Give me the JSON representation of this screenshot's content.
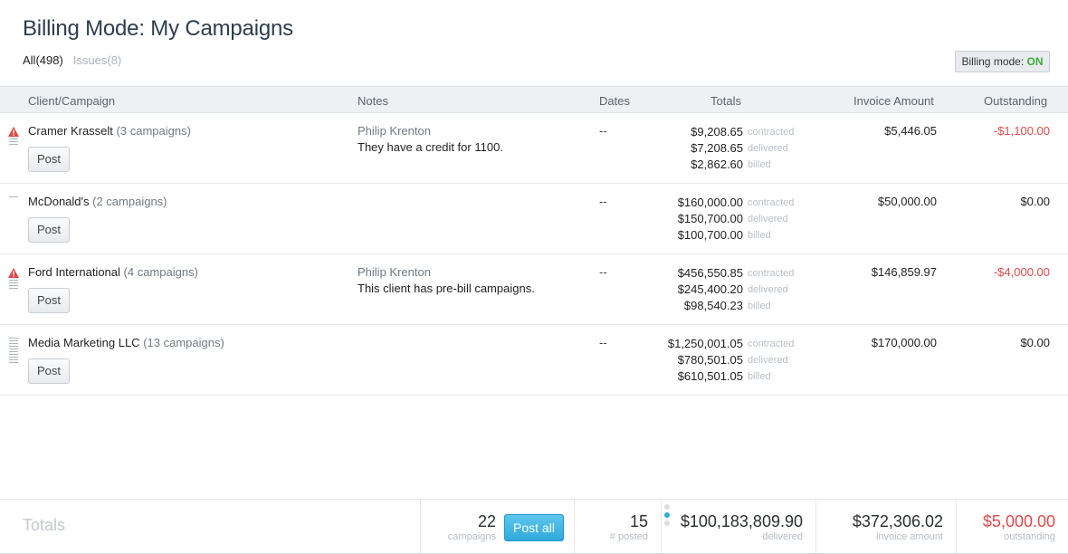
{
  "page": {
    "title": "Billing Mode: My Campaigns"
  },
  "filters": {
    "all": "All(498)",
    "issues": "Issues(8)"
  },
  "billing_mode": {
    "label": "Billing mode:",
    "state": "ON"
  },
  "columns": {
    "client": "Client/Campaign",
    "notes": "Notes",
    "dates": "Dates",
    "totals": "Totals",
    "invoice": "Invoice Amount",
    "outstanding": "Outstanding"
  },
  "total_labels": {
    "contracted": "contracted",
    "delivered": "delivered",
    "billed": "billed"
  },
  "rows": [
    {
      "name": "Cramer Krasselt",
      "campaigns": "(3 campaigns)",
      "warning": true,
      "post": "Post",
      "note_author": "Philip Krenton",
      "note_text": "They have a credit for 1100.",
      "dates": "--",
      "contracted": "$9,208.65",
      "delivered": "$7,208.65",
      "billed": "$2,862.60",
      "invoice": "$5,446.05",
      "outstanding": "-$1,100.00",
      "negative": true
    },
    {
      "name": "McDonald's",
      "campaigns": "(2 campaigns)",
      "warning": false,
      "post": "Post",
      "note_author": "",
      "note_text": "",
      "dates": "--",
      "contracted": "$160,000.00",
      "delivered": "$150,700.00",
      "billed": "$100,700.00",
      "invoice": "$50,000.00",
      "outstanding": "$0.00",
      "negative": false
    },
    {
      "name": "Ford International",
      "campaigns": "(4 campaigns)",
      "warning": true,
      "post": "Post",
      "note_author": "Philip Krenton",
      "note_text": "This client has pre-bill campaigns.",
      "dates": "--",
      "contracted": "$456,550.85",
      "delivered": "$245,400.20",
      "billed": "$98,540.23",
      "invoice": "$146,859.97",
      "outstanding": "-$4,000.00",
      "negative": true
    },
    {
      "name": "Media Marketing LLC",
      "campaigns": "(13 campaigns)",
      "warning": false,
      "post": "Post",
      "note_author": "",
      "note_text": "",
      "dates": "--",
      "contracted": "$1,250,001.05",
      "delivered": "$780,501.05",
      "billed": "$610,501.05",
      "invoice": "$170,000.00",
      "outstanding": "$0.00",
      "negative": false
    }
  ],
  "footer": {
    "label": "Totals",
    "campaigns_count": "22",
    "campaigns_label": "campaigns",
    "post_all": "Post all",
    "posted_count": "15",
    "posted_label": "# posted",
    "delivered_total": "$100,183,809.90",
    "delivered_label": "delivered",
    "invoice_total": "$372,306.02",
    "invoice_label": "invoice amount",
    "outstanding_total": "$5,000.00",
    "outstanding_label": "outstanding"
  },
  "colors": {
    "accent": "#2fa9dc",
    "negative": "#e34a4a",
    "on": "#3cab3c"
  },
  "icons": {
    "warning": "warning-triangle-icon",
    "handle": "drag-handle-icon"
  }
}
